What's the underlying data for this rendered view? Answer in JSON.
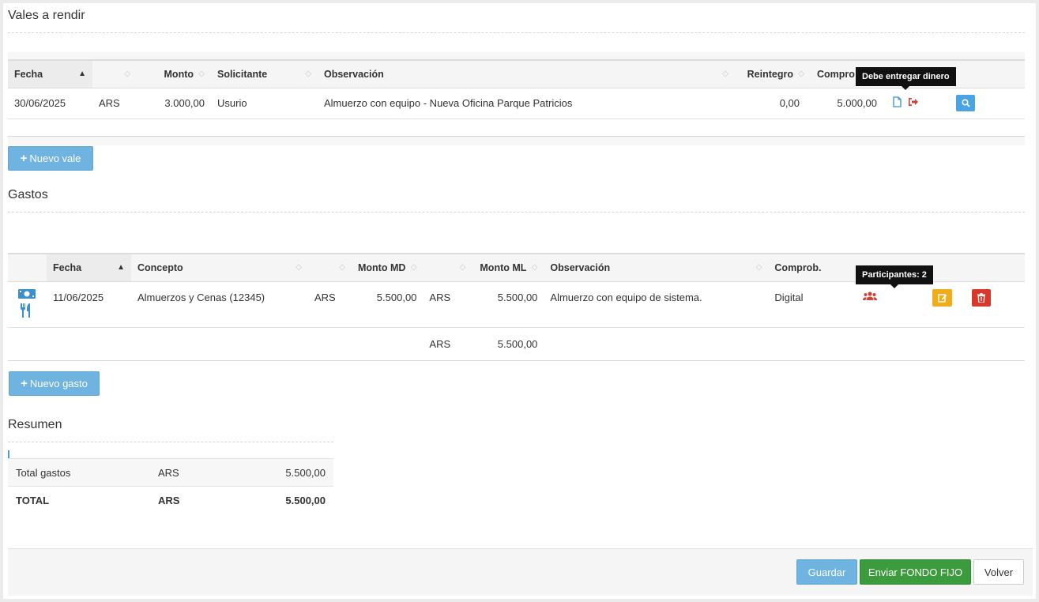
{
  "vales": {
    "title": "Vales a rendir",
    "columns": {
      "fecha": "Fecha",
      "monto": "Monto",
      "solicitante": "Solicitante",
      "observacion": "Observación",
      "reintegro": "Reintegro",
      "comprob": "Compro"
    },
    "rows": [
      {
        "fecha": "30/06/2025",
        "moneda": "ARS",
        "monto": "3.000,00",
        "solicitante": "Usurio",
        "observacion": "Almuerzo con equipo - Nueva Oficina Parque Patricios",
        "reintegro": "0,00",
        "comprobado": "5.000,00"
      }
    ],
    "tooltip": "Debe entregar dinero",
    "new_button": "Nuevo vale"
  },
  "gastos": {
    "title": "Gastos",
    "columns": {
      "fecha": "Fecha",
      "concepto": "Concepto",
      "monto_md": "Monto MD",
      "monto_ml": "Monto ML",
      "observacion": "Observación",
      "comprob": "Comprob."
    },
    "rows": [
      {
        "fecha": "11/06/2025",
        "concepto": "Almuerzos y Cenas (12345)",
        "moneda_md": "ARS",
        "monto_md": "5.500,00",
        "moneda_ml": "ARS",
        "monto_ml": "5.500,00",
        "observacion": "Almuerzo con equipo de sistema.",
        "comprob": "Digital"
      }
    ],
    "total": {
      "moneda": "ARS",
      "monto": "5.500,00"
    },
    "tooltip": "Participantes: 2",
    "new_button": "Nuevo gasto"
  },
  "resumen": {
    "title": "Resumen",
    "rows": [
      {
        "label": "Total gastos",
        "moneda": "ARS",
        "monto": "5.500,00"
      },
      {
        "label": "TOTAL",
        "moneda": "ARS",
        "monto": "5.500,00"
      }
    ]
  },
  "footer": {
    "guardar": "Guardar",
    "enviar": "Enviar FONDO FIJO",
    "volver": "Volver"
  },
  "colors": {
    "blue_button": "#6fb3e0",
    "green_button": "#3c9b3c",
    "orange": "#f0ad1a",
    "red": "#d9372b",
    "icon_red": "#c9463d",
    "icon_blue": "#3a8fd0"
  }
}
